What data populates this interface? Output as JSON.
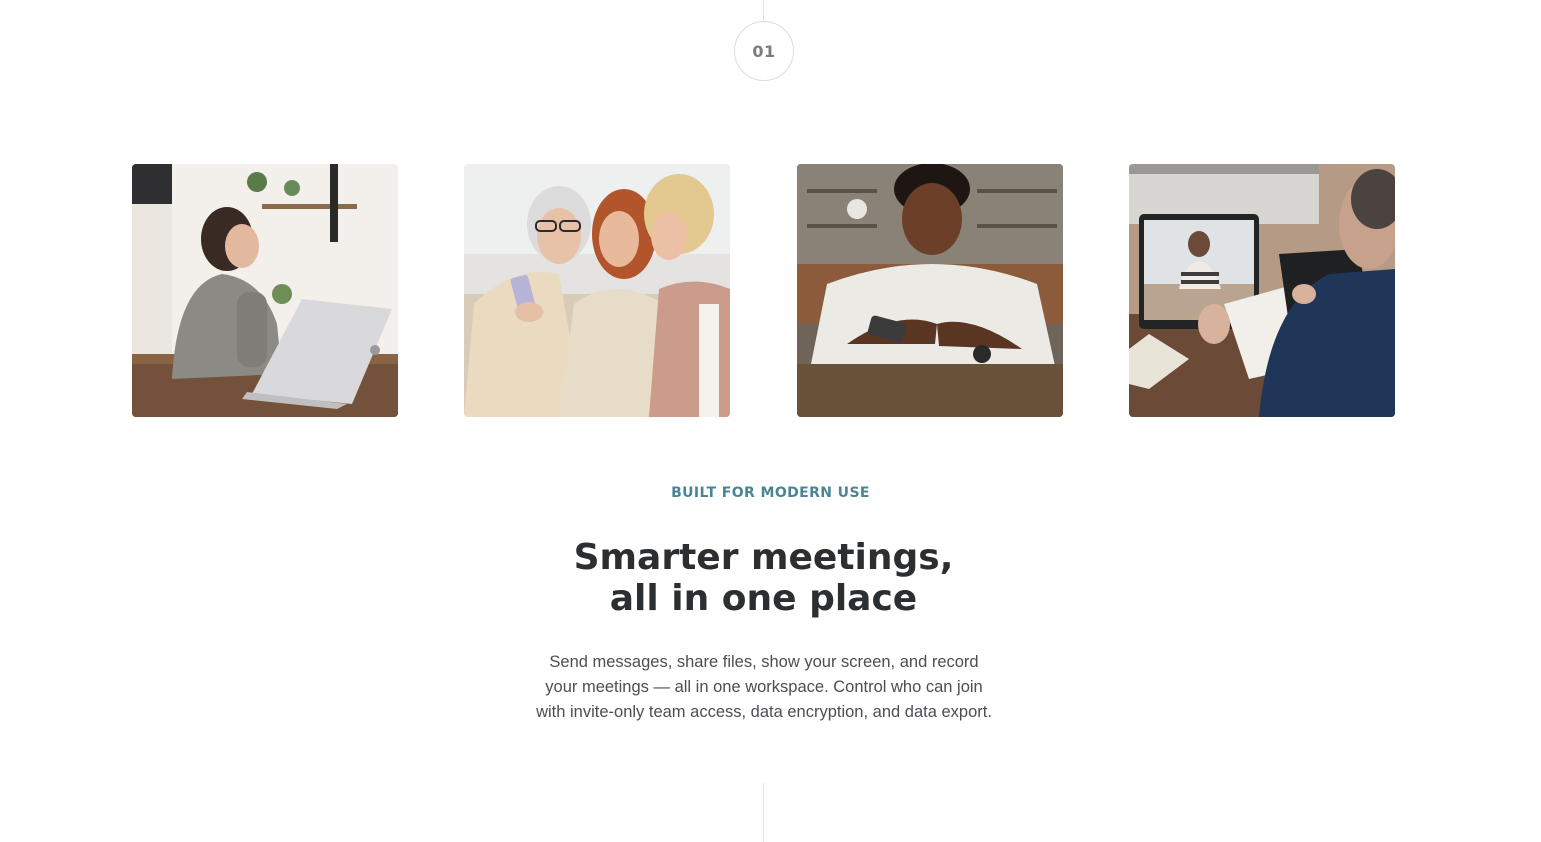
{
  "step": {
    "number": "01"
  },
  "photos": [
    {
      "icon": "photo-woman-laptop-kitchen",
      "alt": ""
    },
    {
      "icon": "photo-women-looking-at-phone",
      "alt": ""
    },
    {
      "icon": "photo-man-using-phone",
      "alt": ""
    },
    {
      "icon": "photo-video-call-laptop",
      "alt": ""
    }
  ],
  "section": {
    "eyebrow": "BUILT FOR MODERN USE",
    "headline_line1": "Smarter meetings,",
    "headline_line2": "all in one place",
    "body": "Send messages, share files, show your screen, and record your meetings — all in one workspace. Control who can join with invite-only team access, data encryption, and data export."
  },
  "colors": {
    "accent": "#4a8594",
    "heading": "#2c2f31",
    "body": "#4b4e52",
    "badge_text": "#7b7c84",
    "line": "#e2e2e4"
  }
}
